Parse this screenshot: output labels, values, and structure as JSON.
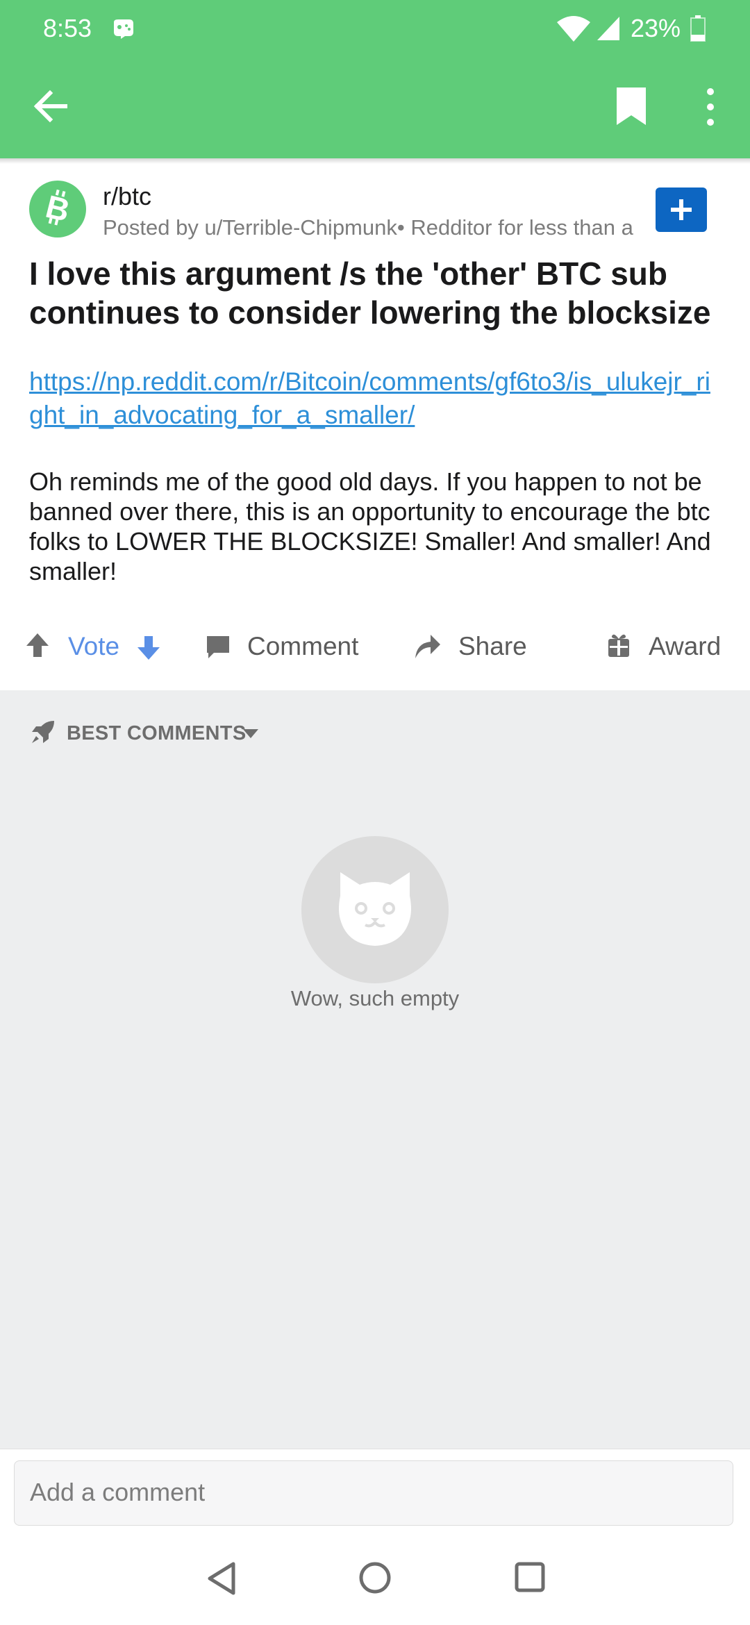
{
  "status_bar": {
    "time": "8:53",
    "battery": "23%",
    "icons": [
      "game-icon",
      "wifi-icon",
      "signal-icon",
      "battery-icon"
    ]
  },
  "app_bar": {
    "icons": [
      "back-arrow-icon",
      "bookmark-icon",
      "more-vert-icon"
    ],
    "color": "#5fcc79"
  },
  "post": {
    "subreddit": "r/btc",
    "meta": "Posted by u/Terrible-Chipmunk• Redditor for less than a",
    "title": "I love this argument /s the 'other' BTC sub continues to consider lowering the blocksize",
    "link": "https://np.reddit.com/r/Bitcoin/comments/gf6to3/is_ulukejr_right_in_advocating_for_a_smaller/",
    "body": "Oh reminds me of the good old days.  If you happen to not be banned over there, this is an opportunity to encourage the btc folks to LOWER THE BLOCKSIZE!   Smaller!  And smaller!  And smaller!"
  },
  "actions": {
    "vote": "Vote",
    "comment": "Comment",
    "share": "Share",
    "award": "Award"
  },
  "comments": {
    "sort_label": "BEST COMMENTS",
    "empty_text": "Wow, such empty"
  },
  "composer": {
    "placeholder": "Add a comment"
  },
  "colors": {
    "accent": "#5fcc79",
    "link": "#2d8fd8",
    "vote": "#5a8fe6",
    "join": "#0d66c2"
  }
}
